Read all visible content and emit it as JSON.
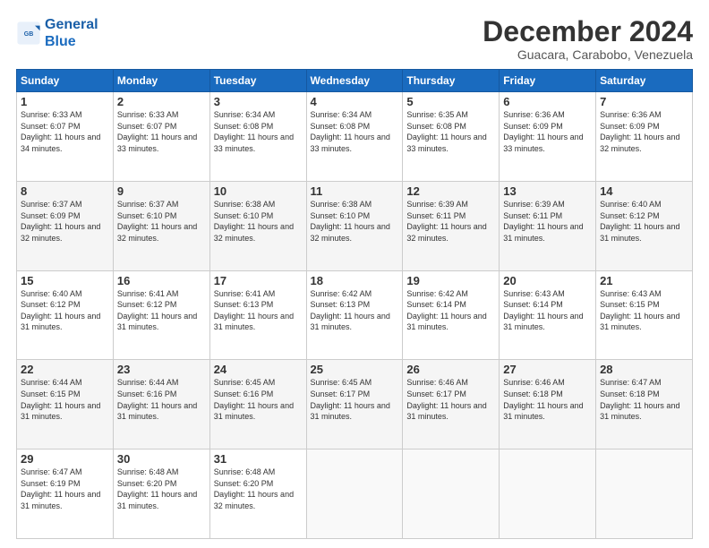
{
  "logo": {
    "line1": "General",
    "line2": "Blue"
  },
  "title": "December 2024",
  "subtitle": "Guacara, Carabobo, Venezuela",
  "days_of_week": [
    "Sunday",
    "Monday",
    "Tuesday",
    "Wednesday",
    "Thursday",
    "Friday",
    "Saturday"
  ],
  "weeks": [
    [
      {
        "day": "1",
        "sunrise": "6:33 AM",
        "sunset": "6:07 PM",
        "daylight": "11 hours and 34 minutes."
      },
      {
        "day": "2",
        "sunrise": "6:33 AM",
        "sunset": "6:07 PM",
        "daylight": "11 hours and 33 minutes."
      },
      {
        "day": "3",
        "sunrise": "6:34 AM",
        "sunset": "6:08 PM",
        "daylight": "11 hours and 33 minutes."
      },
      {
        "day": "4",
        "sunrise": "6:34 AM",
        "sunset": "6:08 PM",
        "daylight": "11 hours and 33 minutes."
      },
      {
        "day": "5",
        "sunrise": "6:35 AM",
        "sunset": "6:08 PM",
        "daylight": "11 hours and 33 minutes."
      },
      {
        "day": "6",
        "sunrise": "6:36 AM",
        "sunset": "6:09 PM",
        "daylight": "11 hours and 33 minutes."
      },
      {
        "day": "7",
        "sunrise": "6:36 AM",
        "sunset": "6:09 PM",
        "daylight": "11 hours and 32 minutes."
      }
    ],
    [
      {
        "day": "8",
        "sunrise": "6:37 AM",
        "sunset": "6:09 PM",
        "daylight": "11 hours and 32 minutes."
      },
      {
        "day": "9",
        "sunrise": "6:37 AM",
        "sunset": "6:10 PM",
        "daylight": "11 hours and 32 minutes."
      },
      {
        "day": "10",
        "sunrise": "6:38 AM",
        "sunset": "6:10 PM",
        "daylight": "11 hours and 32 minutes."
      },
      {
        "day": "11",
        "sunrise": "6:38 AM",
        "sunset": "6:10 PM",
        "daylight": "11 hours and 32 minutes."
      },
      {
        "day": "12",
        "sunrise": "6:39 AM",
        "sunset": "6:11 PM",
        "daylight": "11 hours and 32 minutes."
      },
      {
        "day": "13",
        "sunrise": "6:39 AM",
        "sunset": "6:11 PM",
        "daylight": "11 hours and 31 minutes."
      },
      {
        "day": "14",
        "sunrise": "6:40 AM",
        "sunset": "6:12 PM",
        "daylight": "11 hours and 31 minutes."
      }
    ],
    [
      {
        "day": "15",
        "sunrise": "6:40 AM",
        "sunset": "6:12 PM",
        "daylight": "11 hours and 31 minutes."
      },
      {
        "day": "16",
        "sunrise": "6:41 AM",
        "sunset": "6:12 PM",
        "daylight": "11 hours and 31 minutes."
      },
      {
        "day": "17",
        "sunrise": "6:41 AM",
        "sunset": "6:13 PM",
        "daylight": "11 hours and 31 minutes."
      },
      {
        "day": "18",
        "sunrise": "6:42 AM",
        "sunset": "6:13 PM",
        "daylight": "11 hours and 31 minutes."
      },
      {
        "day": "19",
        "sunrise": "6:42 AM",
        "sunset": "6:14 PM",
        "daylight": "11 hours and 31 minutes."
      },
      {
        "day": "20",
        "sunrise": "6:43 AM",
        "sunset": "6:14 PM",
        "daylight": "11 hours and 31 minutes."
      },
      {
        "day": "21",
        "sunrise": "6:43 AM",
        "sunset": "6:15 PM",
        "daylight": "11 hours and 31 minutes."
      }
    ],
    [
      {
        "day": "22",
        "sunrise": "6:44 AM",
        "sunset": "6:15 PM",
        "daylight": "11 hours and 31 minutes."
      },
      {
        "day": "23",
        "sunrise": "6:44 AM",
        "sunset": "6:16 PM",
        "daylight": "11 hours and 31 minutes."
      },
      {
        "day": "24",
        "sunrise": "6:45 AM",
        "sunset": "6:16 PM",
        "daylight": "11 hours and 31 minutes."
      },
      {
        "day": "25",
        "sunrise": "6:45 AM",
        "sunset": "6:17 PM",
        "daylight": "11 hours and 31 minutes."
      },
      {
        "day": "26",
        "sunrise": "6:46 AM",
        "sunset": "6:17 PM",
        "daylight": "11 hours and 31 minutes."
      },
      {
        "day": "27",
        "sunrise": "6:46 AM",
        "sunset": "6:18 PM",
        "daylight": "11 hours and 31 minutes."
      },
      {
        "day": "28",
        "sunrise": "6:47 AM",
        "sunset": "6:18 PM",
        "daylight": "11 hours and 31 minutes."
      }
    ],
    [
      {
        "day": "29",
        "sunrise": "6:47 AM",
        "sunset": "6:19 PM",
        "daylight": "11 hours and 31 minutes."
      },
      {
        "day": "30",
        "sunrise": "6:48 AM",
        "sunset": "6:20 PM",
        "daylight": "11 hours and 31 minutes."
      },
      {
        "day": "31",
        "sunrise": "6:48 AM",
        "sunset": "6:20 PM",
        "daylight": "11 hours and 32 minutes."
      },
      null,
      null,
      null,
      null
    ]
  ]
}
